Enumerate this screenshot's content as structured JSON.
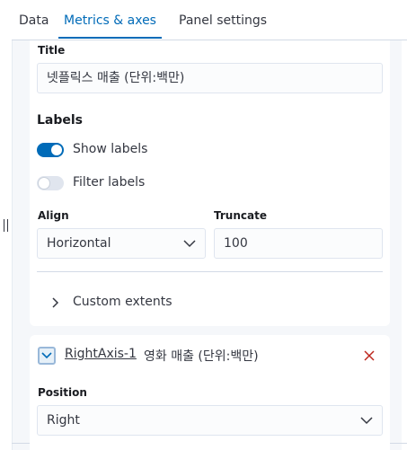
{
  "tabs": {
    "data": "Data",
    "metrics": "Metrics & axes",
    "panel": "Panel settings"
  },
  "value_axis": {
    "title_label": "Title",
    "title_value": "넷플릭스 매출 (단위:백만)",
    "labels_heading": "Labels",
    "show_labels": {
      "label": "Show labels",
      "on": true
    },
    "filter_labels": {
      "label": "Filter labels",
      "on": false
    },
    "align": {
      "label": "Align",
      "value": "Horizontal"
    },
    "truncate": {
      "label": "Truncate",
      "value": "100"
    },
    "custom_extents": "Custom extents"
  },
  "right_axis": {
    "name": "RightAxis-1",
    "title": "영화 매출 (단위:백만)",
    "position_label": "Position",
    "position_value": "Right"
  },
  "colors": {
    "accent": "#006bb8",
    "danger": "#bd271e",
    "switch_off": "#e0e5ee"
  }
}
